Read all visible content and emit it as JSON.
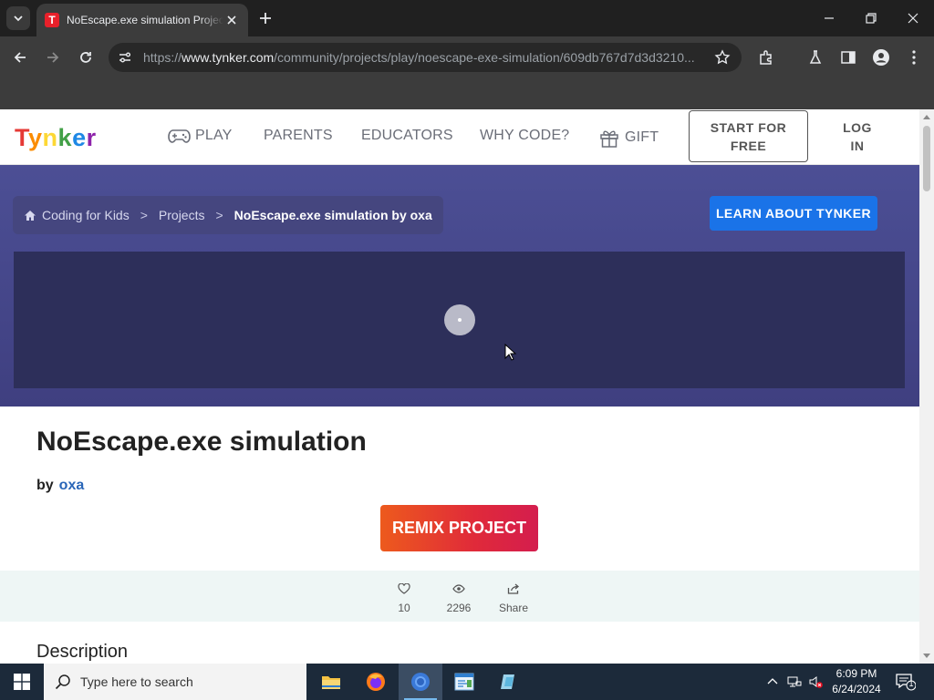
{
  "browser": {
    "tab_title": "NoEscape.exe simulation Project",
    "tab_favicon": "T",
    "url_prefix": "https://",
    "url_host": "www.tynker.com",
    "url_path": "/community/projects/play/noescape-exe-simulation/609db767d7d3d3210..."
  },
  "nav": {
    "logo_text": "TYNKER",
    "items": [
      "PLAY",
      "PARENTS",
      "EDUCATORS",
      "WHY CODE?",
      "GIFT"
    ],
    "start_line1": "START FOR",
    "start_line2": "FREE",
    "login_line1": "LOG",
    "login_line2": "IN"
  },
  "breadcrumb": {
    "home": "Coding for Kids",
    "sep1": ">",
    "projects": "Projects",
    "sep2": ">",
    "current": "NoEscape.exe simulation by oxa"
  },
  "learn_button": "LEARN ABOUT TYNKER",
  "project": {
    "title": "NoEscape.exe simulation",
    "by_label": "by",
    "author": "oxa",
    "remix_label": "REMIX PROJECT",
    "likes": "10",
    "views": "2296",
    "share_label": "Share",
    "description_heading": "Description"
  },
  "taskbar": {
    "search_placeholder": "Type here to search",
    "time": "6:09 PM",
    "date": "6/24/2024",
    "notification_count": "1"
  },
  "colors": {
    "hero_bg": "#4c4f95",
    "player_bg": "#2d2f5a",
    "learn_button": "#1a73e8",
    "remix_start": "#ed5a1d",
    "remix_end": "#d41d4e",
    "author_link": "#2a66b8"
  }
}
